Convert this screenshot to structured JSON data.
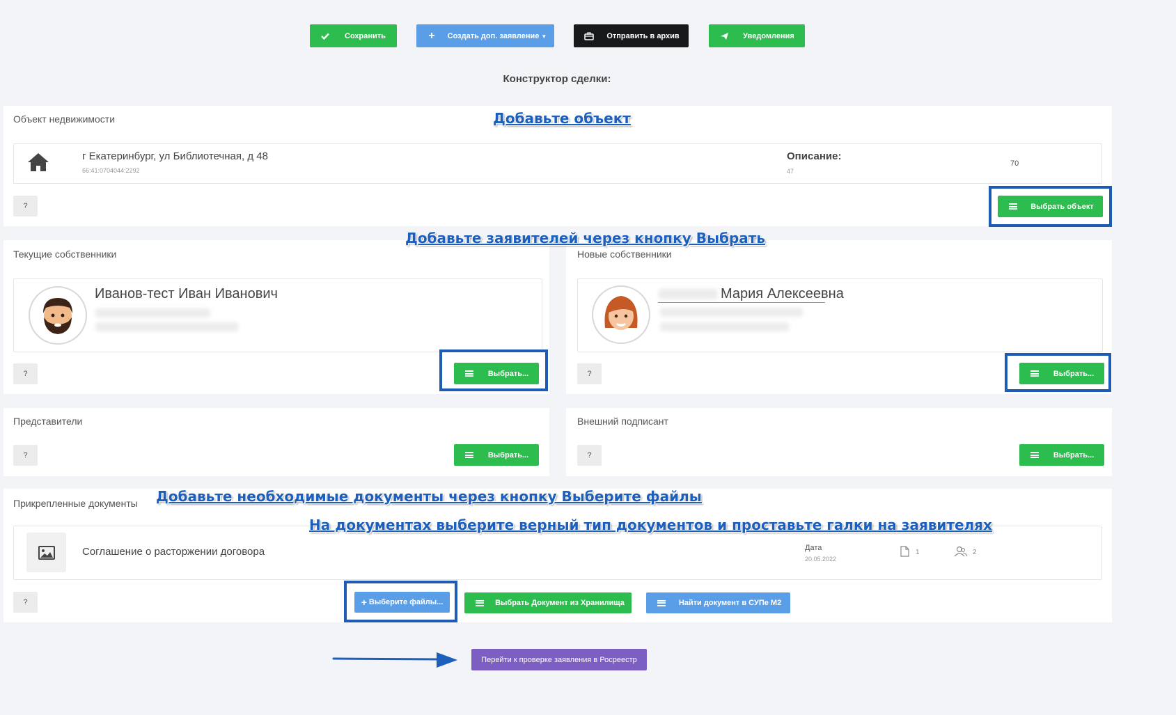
{
  "toolbar": {
    "save_label": "Сохранить",
    "create_label": "Создать доп. заявление",
    "archive_label": "Отправить в архив",
    "notify_label": "Уведомления"
  },
  "page_title": "Конструктор сделки:",
  "property": {
    "section_title": "Объект недвижимости",
    "address": "г Екатеринбург, ул Библиотечная, д 48",
    "cadastral": "66:41:0704044:2292",
    "desc_label": "Описание:",
    "desc_value": "47",
    "extra_value": "70",
    "help_label": "?",
    "select_label": "Выбрать объект"
  },
  "current_owners": {
    "section_title": "Текущие собственники",
    "name": "Иванов-тест Иван Иванович",
    "help_label": "?",
    "select_label": "Выбрать..."
  },
  "new_owners": {
    "section_title": "Новые собственники",
    "name": "Мария Алексеевна",
    "help_label": "?",
    "select_label": "Выбрать..."
  },
  "representatives": {
    "section_title": "Представители",
    "help_label": "?",
    "select_label": "Выбрать..."
  },
  "external_signer": {
    "section_title": "Внешний подписант",
    "help_label": "?",
    "select_label": "Выбрать..."
  },
  "documents": {
    "section_title": "Прикрепленные документы",
    "doc_name": "Соглашение о расторжении договора",
    "date_label": "Дата",
    "date_value": "20.05.2022",
    "files_count": "1",
    "signers_count": "2",
    "help_label": "?",
    "choose_files_label": "Выберите файлы...",
    "storage_label": "Выбрать Документ из Хранилища",
    "find_label": "Найти документ в СУПе М2"
  },
  "submit_label": "Перейти к проверке заявления в Росреестр",
  "annotations": {
    "add_object": "Добавьте объект",
    "add_applicants": "Добавьте заявителей через кнопку Выбрать",
    "add_docs": "Добавьте необходимые документы через кнопку Выберите файлы",
    "doc_types": "На документах выберите верный тип документов и проставьте галки на заявителях"
  },
  "colors": {
    "green": "#2dbd4e",
    "blue": "#5a9ee8",
    "dark": "#18191b",
    "purple": "#7d5fc3",
    "annotation": "#1d5fbd"
  }
}
